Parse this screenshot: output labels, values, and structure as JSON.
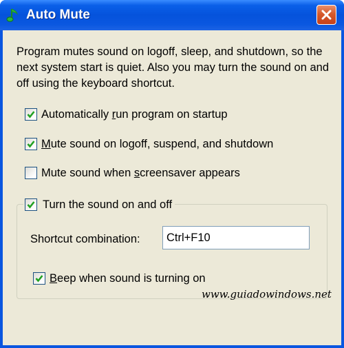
{
  "window": {
    "title": "Auto Mute",
    "app_icon": "music-note-icon",
    "close_icon": "close-icon",
    "colors": {
      "titlebar": "#0553dc",
      "client_bg": "#ece9d8",
      "close_button": "#d65a2c",
      "check_mark": "#21a121"
    }
  },
  "description": "Program mutes sound on logoff, sleep, and shutdown, so the next system start is quiet. Also you may turn the sound on and off using the keyboard shortcut.",
  "options": [
    {
      "label_pre": "Automatically ",
      "accel": "r",
      "label_post": "un program on startup",
      "checked": true
    },
    {
      "label_pre": "",
      "accel": "M",
      "label_post": "ute sound on logoff, suspend, and shutdown",
      "checked": true
    },
    {
      "label_pre": "Mute sound when ",
      "accel": "s",
      "label_post": "creensaver appears",
      "checked": false
    }
  ],
  "toggle_group": {
    "label": "Turn the sound on and off",
    "checked": true,
    "shortcut_label": "Shortcut combination:",
    "shortcut_value": "Ctrl+F10",
    "beep": {
      "label_pre": "",
      "accel": "B",
      "label_post": "eep when sound is turning on",
      "checked": true
    }
  },
  "watermark": "www.guiadowindows.net"
}
